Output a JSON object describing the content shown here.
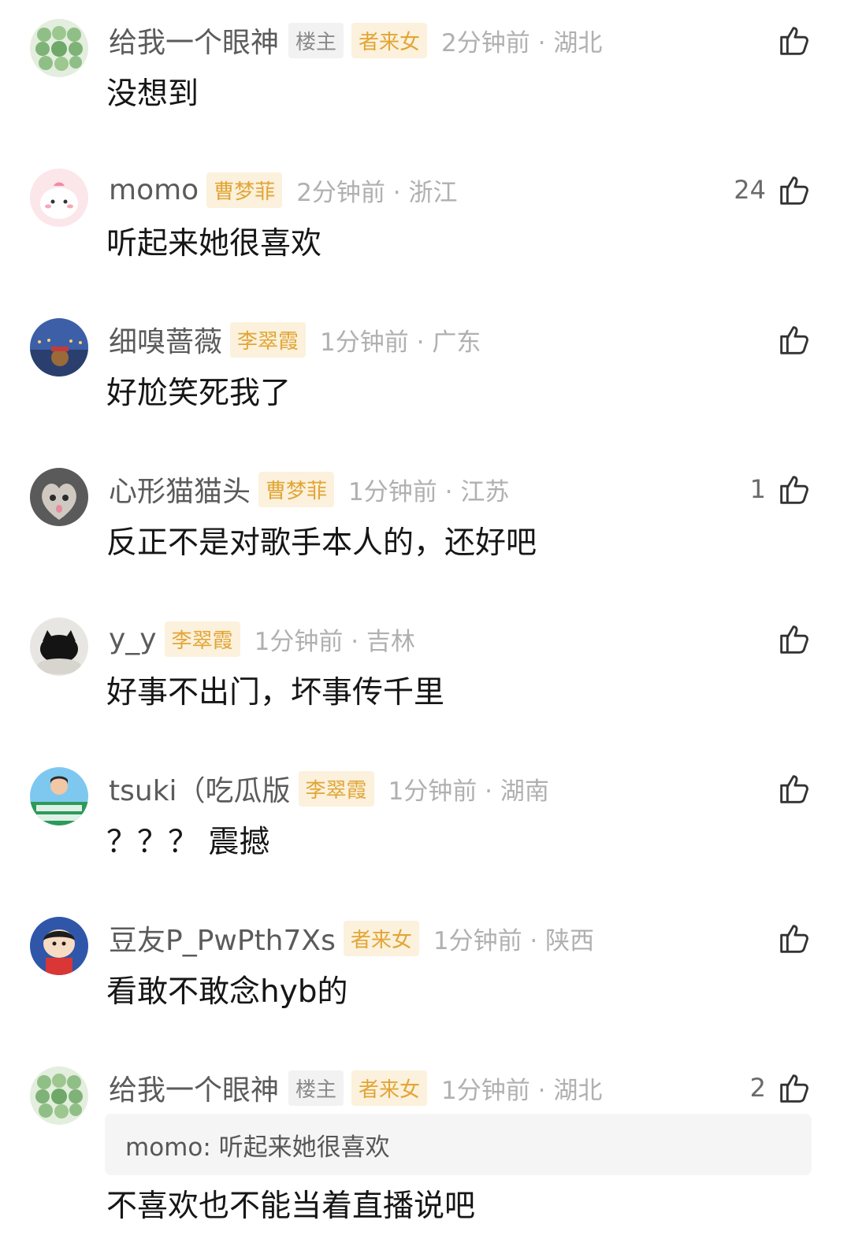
{
  "colors": {
    "group_tag_bg": "#fbf1dc",
    "group_tag_text": "#e2a536",
    "op_tag_bg": "#f2f2f2",
    "time_text": "#b0b0b0",
    "quote_bg": "#f5f5f5"
  },
  "comments": [
    {
      "avatar": "green-badges-avatar",
      "name": "给我一个眼神",
      "op_tag": "楼主",
      "group_tag": "者来女",
      "time": "2分钟前 · 湖北",
      "likes": "",
      "text": "没想到"
    },
    {
      "avatar": "pink-cartoon-avatar",
      "name": "momo",
      "group_tag": "曹梦菲",
      "time": "2分钟前 · 浙江",
      "likes": "24",
      "text": "听起来她很喜欢"
    },
    {
      "avatar": "night-sky-bear-avatar",
      "name": "细嗅蔷薇",
      "group_tag": "李翠霞",
      "time": "1分钟前 · 广东",
      "likes": "",
      "text": "好尬笑死我了"
    },
    {
      "avatar": "heart-cat-avatar",
      "name": "心形猫猫头",
      "group_tag": "曹梦菲",
      "time": "1分钟前 · 江苏",
      "likes": "1",
      "text": "反正不是对歌手本人的，还好吧"
    },
    {
      "avatar": "black-cat-avatar",
      "name": "y_y",
      "group_tag": "李翠霞",
      "time": "1分钟前 · 吉林",
      "likes": "",
      "text": "好事不出门，坏事传千里"
    },
    {
      "avatar": "person-banner-avatar",
      "name": "tsuki（吃瓜版",
      "group_tag": "李翠霞",
      "time": "1分钟前 · 湖南",
      "likes": "",
      "text": "？？？ 震撼"
    },
    {
      "avatar": "cartoon-boy-avatar",
      "name": "豆友P_PwPth7Xs",
      "group_tag": "者来女",
      "time": "1分钟前 · 陕西",
      "likes": "",
      "text": "看敢不敢念hyb的"
    },
    {
      "avatar": "green-badges-avatar",
      "name": "给我一个眼神",
      "op_tag": "楼主",
      "group_tag": "者来女",
      "time": "1分钟前 · 湖北",
      "likes": "2",
      "quote": "momo: 听起来她很喜欢",
      "text": "不喜欢也不能当着直播说吧"
    }
  ]
}
